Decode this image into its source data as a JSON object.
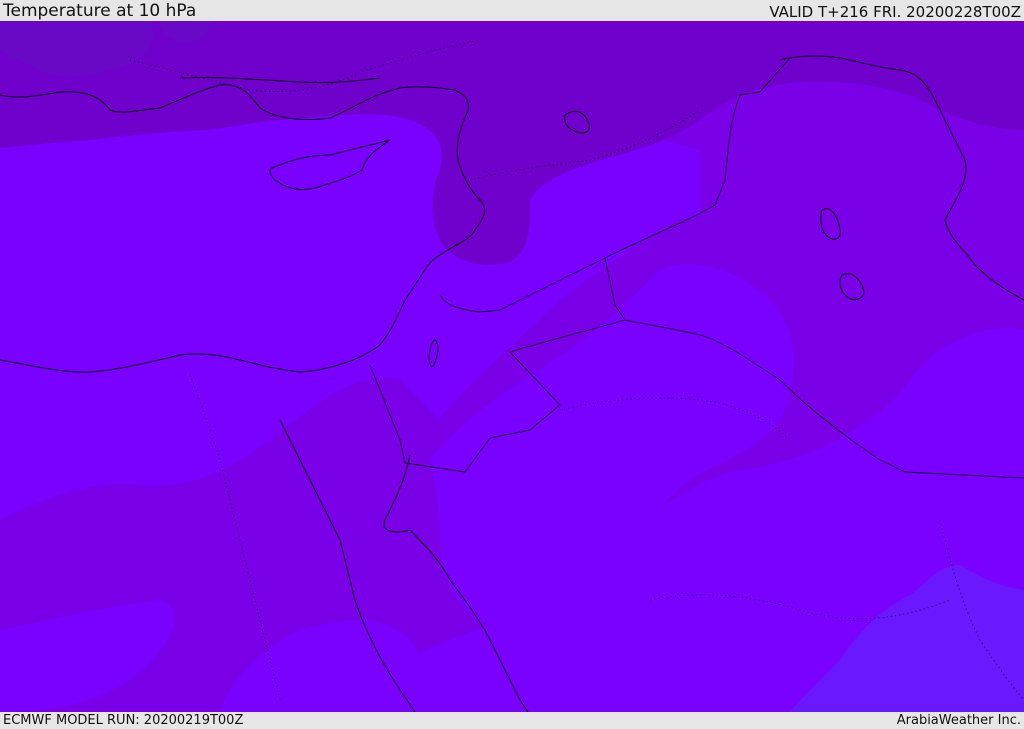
{
  "header": {
    "title": "Temperature at 10 hPa",
    "valid": "VALID T+216 FRI. 20200228T00Z"
  },
  "footer": {
    "model_run": "ECMWF MODEL RUN: 20200219T00Z",
    "provider": "ArabiaWeather Inc."
  },
  "map": {
    "field": "temperature",
    "level": "10 hPa",
    "colors": {
      "coldest": "#6a08c8",
      "cold": "#7000cc",
      "mid": "#7a00e8",
      "warm": "#7a00ff",
      "warmest": "#6a18ff",
      "coastline": "#0a0014"
    }
  }
}
